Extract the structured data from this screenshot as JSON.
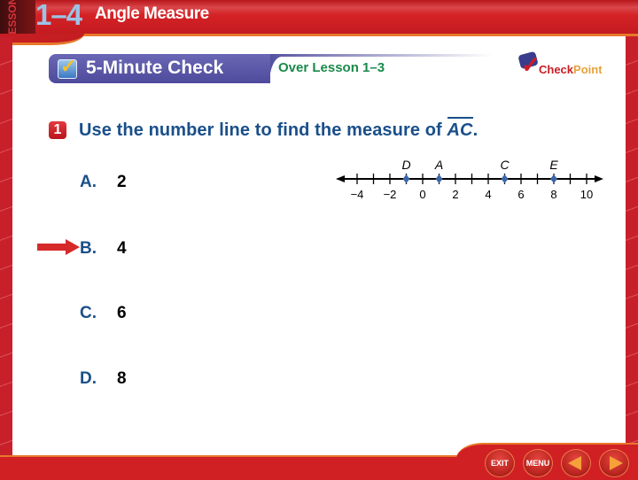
{
  "header": {
    "lesson_label": "LESSON",
    "lesson_number": "1–4",
    "lesson_title": "Angle Measure"
  },
  "subheader": {
    "section_title": "5-Minute Check",
    "over_lesson": "Over Lesson 1–3",
    "logo": {
      "part1": "Check",
      "part2": "Point"
    }
  },
  "question": {
    "number": "1",
    "text": "Use the number line to find the measure of ",
    "segment": "AC",
    "suffix": "."
  },
  "choices": [
    {
      "letter": "A.",
      "value": "2",
      "selected": false
    },
    {
      "letter": "B.",
      "value": "4",
      "selected": true
    },
    {
      "letter": "C.",
      "value": "6",
      "selected": false
    },
    {
      "letter": "D.",
      "value": "8",
      "selected": false
    }
  ],
  "number_line": {
    "min": -4,
    "max": 10,
    "tick_step": 1,
    "labels": [
      "−4",
      "−2",
      "0",
      "2",
      "4",
      "6",
      "8",
      "10"
    ],
    "label_values": [
      -4,
      -2,
      0,
      2,
      4,
      6,
      8,
      10
    ],
    "points": [
      {
        "name": "D",
        "value": -1
      },
      {
        "name": "A",
        "value": 1
      },
      {
        "name": "C",
        "value": 5
      },
      {
        "name": "E",
        "value": 8
      }
    ],
    "point_color": "#3d66a8"
  },
  "nav": {
    "exit": "EXIT",
    "menu": "MENU",
    "prev_icon": "triangle-left",
    "next_icon": "triangle-right"
  },
  "colors": {
    "frame_red": "#d02024",
    "accent_orange": "#e8782a",
    "question_blue": "#1a4f8a",
    "over_green": "#1a8a4a",
    "panel_purple": "#5a57a8"
  }
}
